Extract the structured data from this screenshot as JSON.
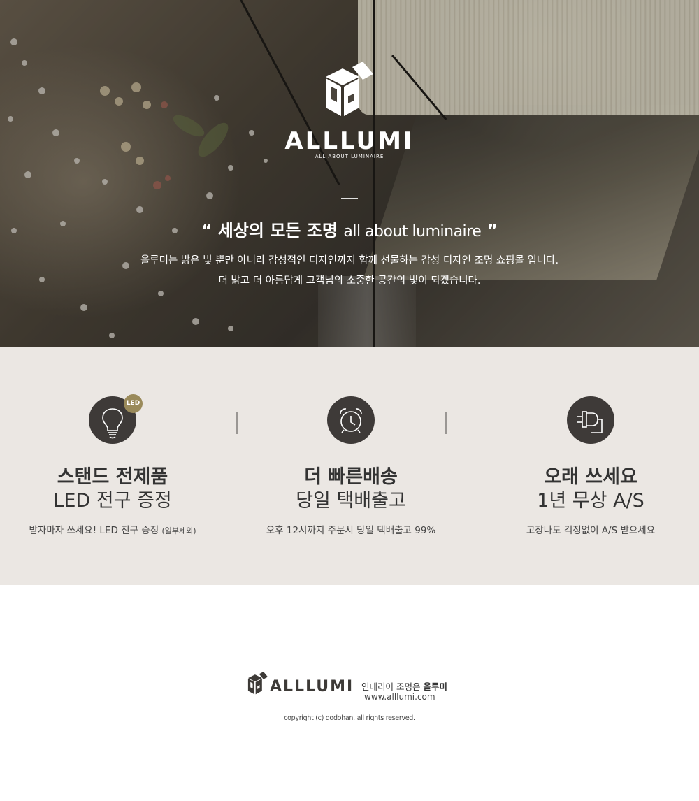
{
  "hero": {
    "brand": "ALLLUMI",
    "tagline": "ALL ABOUT LUMINAIRE",
    "headline_open_quote": "“",
    "headline_ko": "세상의 모든 조명",
    "headline_en": "all about luminaire",
    "headline_close_quote": "”",
    "description_line1": "올루미는 밝은 빛 뿐만 아니라 감성적인 디자인까지 함께 선물하는 감성 디자인 조명 쇼핑몰 입니다.",
    "description_line2": "더 밝고 더 아름답게 고객님의 소중한 공간의 빛이 되겠습니다."
  },
  "features": [
    {
      "icon": "light-bulb-icon",
      "badge": "LED",
      "title": "스탠드 전제품",
      "subtitle": "LED 전구 증정",
      "description": "받자마자 쓰세요! LED 전구 증정",
      "note": "(일부제외)"
    },
    {
      "icon": "alarm-clock-icon",
      "title": "더 빠른배송",
      "subtitle": "당일 택배출고",
      "description": "오후 12시까지 주문시 당일 택배출고 99%"
    },
    {
      "icon": "power-plug-icon",
      "title": "오래 쓰세요",
      "subtitle": "1년 무상 A/S",
      "description": "고장나도 걱정없이 A/S 받으세요"
    }
  ],
  "footer": {
    "brand": "ALLLUMI",
    "slogan_prefix": "인테리어 조명은",
    "slogan_brand": "올루미",
    "url": "www.alllumi.com",
    "copyright": "copyright (c) dodohan. all rights reserved."
  },
  "colors": {
    "feature_bg": "#ebe7e3",
    "icon_circle": "#3e3a38",
    "led_badge": "#9a8a5a",
    "text_dark": "#333333"
  }
}
